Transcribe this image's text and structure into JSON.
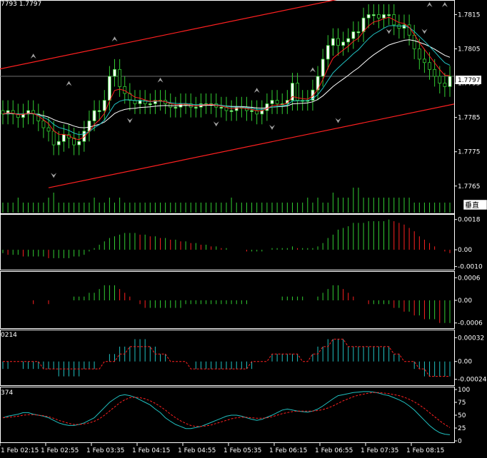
{
  "header": {
    "quote": "7793 1.7797"
  },
  "price_tag": "1.7797",
  "vertical_label": "垂直",
  "osma_header": "0214",
  "stoch_header": "374",
  "colors": {
    "background": "#000000",
    "bull": "#32cd32",
    "bull_body": "#ffffff",
    "bear": "#ffffff",
    "ema_fast": "#ff2020",
    "ema_mid": "#20c0c0",
    "ema_slow": "#ffffff",
    "channel": "#ff2020",
    "fractal": "#a0a0a0",
    "hist_up": "#32cd32",
    "hist_down": "#ff2020",
    "osma": "#20c0c0",
    "signal": "#ff2020",
    "stoch_main": "#20c0c0",
    "stoch_signal": "#ff2020"
  },
  "chart_data": [
    {
      "type": "candlestick",
      "pane": "price",
      "x_labels": [
        "1 Feb 02:15",
        "1 Feb 02:55",
        "1 Feb 03:35",
        "1 Feb 04:15",
        "1 Feb 04:55",
        "1 Feb 05:35",
        "1 Feb 06:15",
        "1 Feb 06:55",
        "1 Feb 07:35",
        "1 Feb 08:15"
      ],
      "y_ticks": [
        1.7765,
        1.7775,
        1.7785,
        1.7795,
        1.7805,
        1.7815
      ],
      "ylim": [
        1.7761,
        1.7818
      ],
      "current_price": 1.7797,
      "close": [
        1.7786,
        1.7787,
        1.7786,
        1.7785,
        1.7786,
        1.7787,
        1.7786,
        1.7784,
        1.7782,
        1.7781,
        1.7777,
        1.7778,
        1.778,
        1.7779,
        1.7777,
        1.7778,
        1.7781,
        1.7784,
        1.7787,
        1.7787,
        1.779,
        1.7797,
        1.7799,
        1.7794,
        1.7792,
        1.779,
        1.7789,
        1.779,
        1.7789,
        1.7789,
        1.779,
        1.779,
        1.7789,
        1.7788,
        1.7788,
        1.7789,
        1.7789,
        1.7788,
        1.7788,
        1.7789,
        1.7789,
        1.7789,
        1.7788,
        1.7788,
        1.7787,
        1.7787,
        1.7788,
        1.7788,
        1.7787,
        1.7787,
        1.7786,
        1.7787,
        1.7789,
        1.779,
        1.7789,
        1.7789,
        1.779,
        1.7795,
        1.779,
        1.779,
        1.779,
        1.7793,
        1.7797,
        1.7802,
        1.7806,
        1.7808,
        1.7806,
        1.7807,
        1.7808,
        1.781,
        1.781,
        1.7814,
        1.7815,
        1.7815,
        1.7814,
        1.7815,
        1.7815,
        1.7812,
        1.7811,
        1.7812,
        1.7809,
        1.7805,
        1.7802,
        1.7801,
        1.7799,
        1.7797,
        1.7795,
        1.7794,
        1.7797
      ],
      "fractals_up": [
        [
          6,
          1.7803
        ],
        [
          13,
          1.7795
        ],
        [
          22,
          1.7808
        ],
        [
          31,
          1.7796
        ],
        [
          50,
          1.7793
        ],
        [
          61,
          1.7799
        ],
        [
          84,
          1.7818
        ],
        [
          87,
          1.7818
        ]
      ],
      "fractals_down": [
        [
          10,
          1.7768
        ],
        [
          25,
          1.7784
        ],
        [
          42,
          1.7783
        ],
        [
          53,
          1.7782
        ],
        [
          66,
          1.7784
        ],
        [
          76,
          1.781
        ],
        [
          83,
          1.781
        ]
      ]
    },
    {
      "type": "bar",
      "pane": "volume",
      "values": [
        2,
        2,
        2,
        3,
        2,
        2,
        2,
        2,
        2,
        3,
        4,
        2,
        2,
        2,
        2,
        2,
        2,
        2,
        3,
        2,
        2,
        3,
        2,
        3,
        2,
        2,
        2,
        2,
        2,
        2,
        2,
        2,
        2,
        2,
        2,
        2,
        2,
        2,
        2,
        2,
        2,
        2,
        2,
        2,
        2,
        3,
        2,
        2,
        2,
        2,
        2,
        2,
        2,
        2,
        2,
        2,
        2,
        2,
        2,
        2,
        3,
        2,
        3,
        2,
        2,
        4,
        3,
        3,
        3,
        5,
        5,
        3,
        3,
        3,
        3,
        3,
        3,
        3,
        3,
        3,
        3,
        2,
        2,
        2,
        2,
        2,
        2,
        2,
        2
      ]
    },
    {
      "type": "histogram",
      "pane": "macd",
      "y_ticks": [
        0.0018,
        0.0,
        -0.001
      ],
      "ylim": [
        -0.0011,
        0.002
      ],
      "values": [
        -0.0002,
        -0.0003,
        -0.0003,
        -0.0003,
        -0.0004,
        -0.0004,
        -0.0004,
        -0.0004,
        -0.0004,
        -0.0005,
        -0.0005,
        -0.0005,
        -0.0005,
        -0.0005,
        -0.0004,
        -0.0004,
        -0.0003,
        -0.0001,
        0.0001,
        0.0003,
        0.0005,
        0.0007,
        0.0008,
        0.0009,
        0.001,
        0.001,
        0.001,
        0.0009,
        0.0009,
        0.0008,
        0.0008,
        0.0007,
        0.0007,
        0.0006,
        0.0006,
        0.0005,
        0.0005,
        0.0004,
        0.0004,
        0.0003,
        0.0003,
        0.0002,
        0.0002,
        0.0001,
        0.0001,
        0.0,
        0.0,
        0.0,
        -0.0001,
        -0.0001,
        -0.0001,
        -0.0001,
        0.0,
        0.0001,
        0.0001,
        0.0001,
        0.0001,
        0.0002,
        0.0001,
        0.0001,
        0.0001,
        0.0001,
        0.0002,
        0.0004,
        0.0007,
        0.0009,
        0.0012,
        0.0013,
        0.0014,
        0.0016,
        0.0016,
        0.0016,
        0.0017,
        0.0017,
        0.0017,
        0.0017,
        0.0018,
        0.0017,
        0.0016,
        0.0015,
        0.0013,
        0.0011,
        0.0008,
        0.0006,
        0.0004,
        0.0002,
        0.0,
        -0.0001,
        -0.0002
      ]
    },
    {
      "type": "histogram",
      "pane": "osma",
      "y_ticks": [
        0.0006,
        0.0,
        -0.0006
      ],
      "ylim": [
        -0.0007,
        0.0007
      ],
      "values": [
        0.0,
        0.0,
        0.0,
        0.0,
        0.0,
        0.0,
        -0.0001,
        0.0,
        0.0,
        -0.0001,
        0.0,
        0.0,
        0.0,
        0.0,
        0.0001,
        0.0001,
        0.0001,
        0.0002,
        0.0002,
        0.0003,
        0.0004,
        0.0004,
        0.0004,
        0.0003,
        0.0002,
        0.0001,
        0.0,
        -0.0001,
        -0.0002,
        -0.0002,
        -0.0002,
        -0.0002,
        -0.0002,
        -0.0002,
        -0.0002,
        -0.0002,
        -0.0001,
        -0.0001,
        -0.0001,
        -0.0001,
        -0.0001,
        -0.0001,
        -0.0001,
        -0.0001,
        -0.0001,
        -0.0001,
        -0.0001,
        -0.0001,
        -0.0001,
        0.0,
        0.0,
        0.0,
        0.0,
        0.0,
        0.0,
        0.0001,
        0.0001,
        0.0001,
        0.0001,
        0.0001,
        0.0,
        0.0,
        0.0001,
        0.0002,
        0.0003,
        0.0004,
        0.0004,
        0.0003,
        0.0002,
        0.0001,
        0.0,
        0.0,
        -0.0001,
        -0.0001,
        -0.0001,
        -0.0001,
        -0.0001,
        -0.0002,
        -0.0002,
        -0.0003,
        -0.0003,
        -0.0004,
        -0.0004,
        -0.0005,
        -0.0005,
        -0.0005,
        -0.0006,
        -0.0006,
        -0.0006
      ]
    },
    {
      "type": "bar_line",
      "pane": "osma_signal",
      "y_ticks": [
        0.00032,
        0.0,
        -0.00024
      ],
      "ylim": [
        -0.0003,
        0.0004
      ],
      "bars": [
        -0.0001,
        -0.0001,
        0.0,
        0.0,
        -0.0001,
        -0.0001,
        -0.0001,
        -0.0001,
        -0.0001,
        -0.0001,
        -0.0001,
        -0.0002,
        -0.0002,
        -0.0002,
        -0.0002,
        -0.0002,
        -0.0001,
        -0.0001,
        -0.0001,
        0.0,
        0.0,
        0.0001,
        0.0001,
        0.0002,
        0.0002,
        0.0002,
        0.0003,
        0.0003,
        0.0003,
        0.0002,
        0.0002,
        0.0001,
        0.0001,
        0.0,
        0.0,
        0.0,
        0.0,
        0.0,
        -0.0001,
        -0.0001,
        -0.0001,
        -0.0001,
        -0.0001,
        -0.0001,
        -0.0001,
        -0.0001,
        -0.0001,
        -0.0001,
        -0.0001,
        -0.0001,
        0.0,
        0.0,
        0.0,
        0.0001,
        0.0001,
        0.0001,
        0.0001,
        0.0001,
        0.0001,
        0.0,
        0.0,
        0.0001,
        0.0002,
        0.0002,
        0.0003,
        0.0003,
        0.0003,
        0.0003,
        0.0002,
        0.0002,
        0.0002,
        0.0002,
        0.0002,
        0.0002,
        0.0002,
        0.0002,
        0.0002,
        0.0001,
        0.0001,
        0.0,
        0.0,
        -0.0001,
        -0.0001,
        -0.0002,
        -0.0002,
        -0.0002,
        -0.0002,
        -0.0002,
        -0.0002
      ],
      "signal": [
        0.0,
        0.0,
        0.0,
        0.0,
        0.0,
        0.0,
        0.0,
        0.0,
        -0.0001,
        -0.0001,
        -0.0001,
        -0.0001,
        -0.0001,
        -0.0001,
        -0.0001,
        -0.0001,
        -0.0001,
        -0.0001,
        -0.0001,
        -0.0001,
        0.0,
        0.0,
        0.0,
        0.0001,
        0.0001,
        0.0002,
        0.0002,
        0.0002,
        0.0002,
        0.0002,
        0.0001,
        0.0001,
        0.0001,
        0.0,
        0.0,
        0.0,
        0.0,
        -0.0001,
        -0.0001,
        -0.0001,
        -0.0001,
        -0.0001,
        -0.0001,
        -0.0001,
        -0.0001,
        -0.0001,
        -0.0001,
        -0.0001,
        -0.0001,
        0.0,
        0.0,
        0.0,
        0.0,
        0.0001,
        0.0001,
        0.0001,
        0.0001,
        0.0001,
        0.0001,
        0.0,
        0.0,
        0.0001,
        0.0001,
        0.0002,
        0.0002,
        0.0003,
        0.0003,
        0.0003,
        0.0002,
        0.0002,
        0.0002,
        0.0002,
        0.0002,
        0.0002,
        0.0002,
        0.0002,
        0.0002,
        0.0001,
        0.0001,
        0.0,
        0.0,
        0.0,
        -0.0001,
        -0.0001,
        -0.0002,
        -0.0002,
        -0.0002,
        -0.0002,
        -0.0002
      ]
    },
    {
      "type": "line",
      "pane": "stochastic",
      "y_ticks": [
        100,
        75,
        50,
        25,
        0
      ],
      "ylim": [
        0,
        100
      ],
      "series": [
        {
          "values": [
            45,
            48,
            50,
            52,
            55,
            55,
            52,
            50,
            48,
            45,
            40,
            35,
            32,
            30,
            30,
            32,
            35,
            40,
            45,
            55,
            65,
            75,
            82,
            88,
            90,
            88,
            85,
            80,
            75,
            70,
            62,
            55,
            45,
            38,
            32,
            28,
            24,
            24,
            26,
            28,
            32,
            36,
            40,
            44,
            48,
            50,
            50,
            48,
            45,
            42,
            40,
            42,
            46,
            50,
            55,
            60,
            62,
            60,
            58,
            57,
            56,
            58,
            62,
            68,
            75,
            82,
            88,
            90,
            92,
            94,
            95,
            96,
            96,
            95,
            93,
            90,
            88,
            84,
            80,
            75,
            68,
            60,
            50,
            40,
            30,
            22,
            16,
            13,
            12
          ]
        },
        {
          "values": [
            45,
            46,
            47,
            48,
            50,
            51,
            51,
            50,
            49,
            47,
            44,
            40,
            37,
            34,
            32,
            32,
            33,
            35,
            38,
            43,
            50,
            58,
            66,
            74,
            80,
            84,
            85,
            84,
            82,
            78,
            73,
            67,
            60,
            52,
            45,
            39,
            34,
            30,
            28,
            28,
            29,
            31,
            34,
            37,
            40,
            43,
            45,
            46,
            46,
            45,
            44,
            44,
            45,
            47,
            50,
            53,
            55,
            57,
            58,
            58,
            58,
            58,
            59,
            61,
            64,
            68,
            73,
            78,
            82,
            86,
            89,
            91,
            93,
            94,
            94,
            93,
            92,
            90,
            88,
            85,
            81,
            76,
            70,
            63,
            55,
            47,
            39,
            32,
            26
          ]
        }
      ]
    }
  ]
}
